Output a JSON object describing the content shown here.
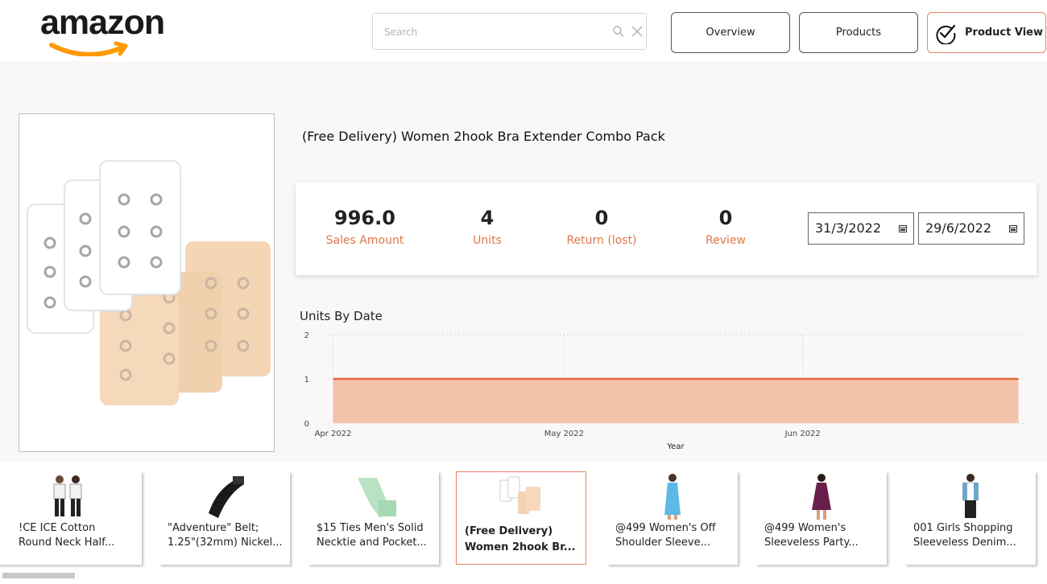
{
  "header": {
    "logo_text": "amazon",
    "search": {
      "placeholder": "Search",
      "value": ""
    },
    "nav": {
      "overview_label": "Overview",
      "products_label": "Products",
      "product_view_label": "Product View"
    }
  },
  "product": {
    "title": "(Free Delivery) Women 2hook Bra Extender Combo Pack"
  },
  "kpis": {
    "sales_amount": {
      "value": "996.0",
      "label": "Sales Amount"
    },
    "units": {
      "value": "4",
      "label": "Units"
    },
    "returns": {
      "value": "0",
      "label": "Return (lost)"
    },
    "review": {
      "value": "0",
      "label": "Review"
    }
  },
  "date_range": {
    "start": "31/3/2022",
    "end": "29/6/2022"
  },
  "chart_title": "Units By Date",
  "chart_data": {
    "type": "area",
    "title": "Units By Date",
    "xlabel": "Year",
    "ylabel": "",
    "x_ticks": [
      "Apr 2022",
      "May 2022",
      "Jun 2022"
    ],
    "y_ticks": [
      "0",
      "1",
      "2"
    ],
    "ylim": [
      0,
      2
    ],
    "x": [
      "2022-04-01",
      "2022-06-29"
    ],
    "series": [
      {
        "values": [
          1,
          1
        ]
      }
    ],
    "grid": true,
    "colors": {
      "line": "#e4673d",
      "fill": "#f4c1ab"
    }
  },
  "product_strip": [
    {
      "line1": "!CE ICE Cotton",
      "line2": "Round Neck Half...",
      "icon": "kids-tshirt-icon",
      "selected": false
    },
    {
      "line1": "\"Adventure\" Belt;",
      "line2": "1.25\"(32mm) Nickel...",
      "icon": "belt-icon",
      "selected": false
    },
    {
      "line1": "$15 Ties Men's Solid",
      "line2": "Necktie and Pocket...",
      "icon": "necktie-icon",
      "selected": false
    },
    {
      "line1": "(Free Delivery)",
      "line2": "Women 2hook Br...",
      "icon": "bra-extender-icon",
      "selected": true
    },
    {
      "line1": "@499 Women's Off",
      "line2": "Shoulder Sleeve...",
      "icon": "blue-dress-icon",
      "selected": false
    },
    {
      "line1": "@499 Women's",
      "line2": "Sleeveless Party...",
      "icon": "purple-dress-icon",
      "selected": false
    },
    {
      "line1": "001 Girls Shopping",
      "line2": "Sleeveless Denim...",
      "icon": "denim-vest-icon",
      "selected": false
    }
  ],
  "colors": {
    "accent": "#e0784a",
    "active_border": "#e8845f",
    "logo_smile": "#ff9900"
  }
}
